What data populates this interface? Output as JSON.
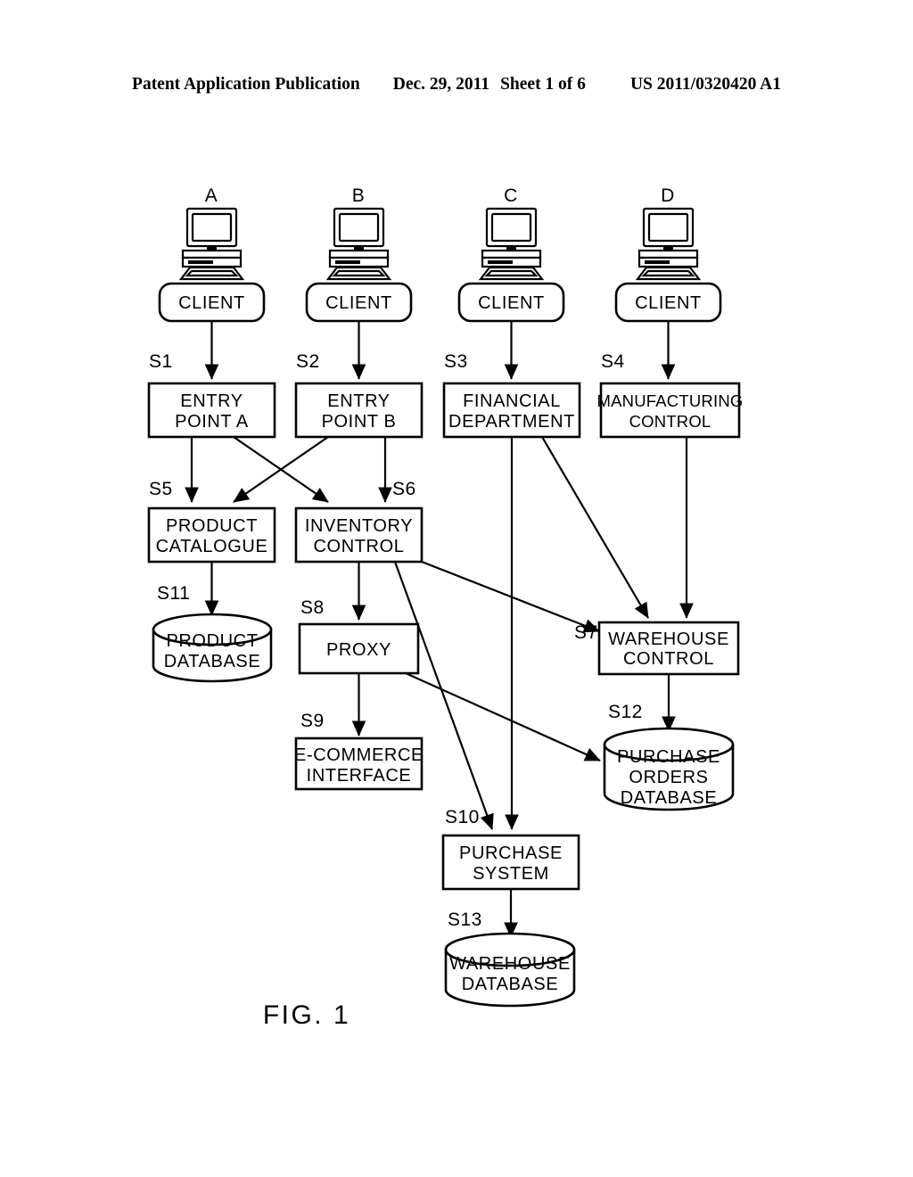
{
  "header": {
    "publication": "Patent Application Publication",
    "date": "Dec. 29, 2011",
    "sheet": "Sheet 1 of 6",
    "number": "US 2011/0320420 A1"
  },
  "figure": {
    "caption": "FIG. 1"
  },
  "terminals": [
    {
      "id": "A",
      "label": "A",
      "client": "CLIENT"
    },
    {
      "id": "B",
      "label": "B",
      "client": "CLIENT"
    },
    {
      "id": "C",
      "label": "C",
      "client": "CLIENT"
    },
    {
      "id": "D",
      "label": "D",
      "client": "CLIENT"
    }
  ],
  "nodes": {
    "entry_point_a": {
      "step": "S1",
      "line1": "ENTRY",
      "line2": "POINT A"
    },
    "entry_point_b": {
      "step": "S2",
      "line1": "ENTRY",
      "line2": "POINT B"
    },
    "financial_dept": {
      "step": "S3",
      "line1": "FINANCIAL",
      "line2": "DEPARTMENT"
    },
    "manufacturing": {
      "step": "S4",
      "line1": "MANUFACTURING",
      "line2": "CONTROL"
    },
    "product_cat": {
      "step": "S5",
      "line1": "PRODUCT",
      "line2": "CATALOGUE"
    },
    "inventory_ctrl": {
      "step": "S6",
      "line1": "INVENTORY",
      "line2": "CONTROL"
    },
    "warehouse_ctrl": {
      "step": "S7",
      "line1": "WAREHOUSE",
      "line2": "CONTROL"
    },
    "proxy": {
      "step": "S8",
      "line1": "PROXY",
      "line2": ""
    },
    "ecommerce": {
      "step": "S9",
      "line1": "E-COMMERCE",
      "line2": "INTERFACE"
    },
    "purchase_sys": {
      "step": "S10",
      "line1": "PURCHASE",
      "line2": "SYSTEM"
    },
    "product_db": {
      "step": "S11",
      "line1": "PRODUCT",
      "line2": "DATABASE",
      "line3": ""
    },
    "purchase_db": {
      "step": "S12",
      "line1": "PURCHASE",
      "line2": "ORDERS",
      "line3": "DATABASE"
    },
    "warehouse_db": {
      "step": "S13",
      "line1": "WAREHOUSE",
      "line2": "DATABASE",
      "line3": ""
    }
  },
  "colors": {
    "ink": "#000000",
    "paper": "#ffffff"
  }
}
